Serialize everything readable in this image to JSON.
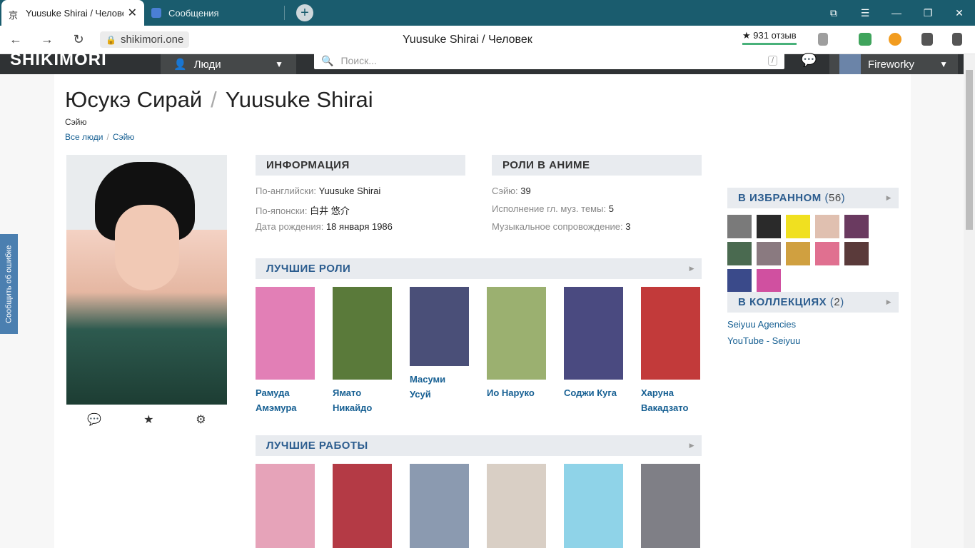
{
  "browser": {
    "tabs": [
      {
        "title": "Yuusuke Shirai / Человек",
        "close": "✕"
      },
      {
        "title": "Сообщения"
      }
    ],
    "new_tab": "+",
    "url": "shikimori.one",
    "page_title": "Yuusuke Shirai / Человек",
    "reviews": "★ 931 отзыв",
    "window_buttons": [
      "⧉",
      "☰",
      "—",
      "❐",
      "✕"
    ],
    "nav": {
      "back": "←",
      "forward": "→",
      "reload": "↻"
    }
  },
  "site": {
    "logo": "SHIKIMORI",
    "section": "Люди",
    "search_placeholder": "Поиск...",
    "search_shortcut": "/",
    "user": "Fireworky"
  },
  "report_tab": "Сообщить об ошибке",
  "person": {
    "name_ru": "Юсукэ Сирай",
    "name_sep": "/",
    "name_en": "Yuusuke Shirai",
    "role": "Сэйю",
    "breadcrumbs": [
      "Все люди",
      "Сэйю"
    ]
  },
  "info": {
    "title": "ИНФОРМАЦИЯ",
    "rows": [
      {
        "label": "По-английски:",
        "value": "Yuusuke Shirai"
      },
      {
        "label": "По-японски:",
        "value": "白井 悠介"
      },
      {
        "label": "Дата рождения:",
        "value": "18 января 1986"
      }
    ]
  },
  "anime_roles": {
    "title": "РОЛИ В АНИМЕ",
    "rows": [
      {
        "label": "Сэйю:",
        "value": "39"
      },
      {
        "label": "Исполнение гл. муз. темы:",
        "value": "5"
      },
      {
        "label": "Музыкальное сопровождение:",
        "value": "3"
      }
    ]
  },
  "best_roles": {
    "title": "ЛУЧШИЕ РОЛИ",
    "items": [
      {
        "name": "Рамуда Амэмура",
        "color": "#e27fb6"
      },
      {
        "name": "Ямато Никайдо",
        "color": "#5a7a3a"
      },
      {
        "name": "Масуми Усуй",
        "color": "#4a4f78"
      },
      {
        "name": "Ио Наруко",
        "color": "#9bb070"
      },
      {
        "name": "Соджи Куга",
        "color": "#4a4a80"
      },
      {
        "name": "Харуна Вакадзато",
        "color": "#c23a3a"
      }
    ]
  },
  "best_works": {
    "title": "ЛУЧШИЕ РАБОТЫ",
    "colors": [
      "#e6a3b9",
      "#b43a45",
      "#8b9ab0",
      "#d9cfc5",
      "#8fd3e8",
      "#7f7f86"
    ]
  },
  "favorites": {
    "title": "В ИЗБРАННОМ",
    "count": "56",
    "colors": [
      "#7a7a7a",
      "#2a2a2a",
      "#f0e020",
      "#e0c0b0",
      "#6a3a60",
      "#4a6a50",
      "#8a7a80",
      "#d0a040",
      "#e07090",
      "#5a3a3a",
      "#3a4a8a",
      "#d050a0"
    ]
  },
  "collections": {
    "title": "В КОЛЛЕКЦИЯХ",
    "count": "2",
    "items": [
      "Seiyuu Agencies",
      "YouTube - Seiyuu"
    ]
  }
}
